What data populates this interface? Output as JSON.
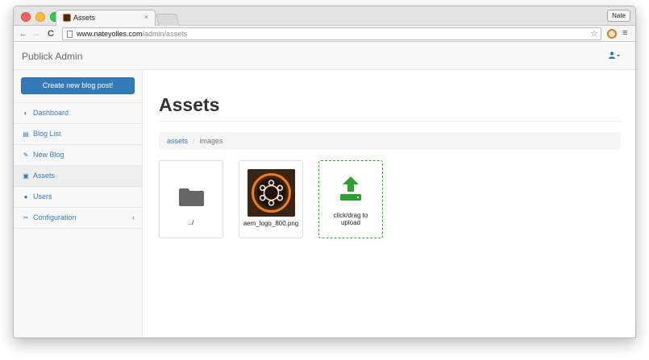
{
  "browser": {
    "tab_title": "Assets",
    "tab_close": "×",
    "profile_name": "Nate",
    "url_host": "www.nateyolles.com",
    "url_path": "/admin/assets",
    "back": "←",
    "forward": "→",
    "reload": "C",
    "star": "☆",
    "menu": "≡"
  },
  "app": {
    "brand": "Publick Admin",
    "user_menu": "▲ ▾"
  },
  "sidebar": {
    "create_button": "Create new blog post!",
    "items": [
      {
        "label": "Dashboard",
        "icon": "dashboard-icon",
        "glyph": "◐"
      },
      {
        "label": "Blog List",
        "icon": "list-icon",
        "glyph": "▤"
      },
      {
        "label": "New Blog",
        "icon": "pencil-icon",
        "glyph": "✎"
      },
      {
        "label": "Assets",
        "icon": "image-icon",
        "glyph": "▣"
      },
      {
        "label": "Users",
        "icon": "user-icon",
        "glyph": "●"
      },
      {
        "label": "Configuration",
        "icon": "wrench-icon",
        "glyph": "✂",
        "caret": "‹"
      }
    ]
  },
  "main": {
    "title": "Assets",
    "breadcrumb": {
      "root": "assets",
      "separator": "/",
      "current": "images"
    },
    "tiles": [
      {
        "type": "folder",
        "label": "../"
      },
      {
        "type": "image",
        "label": "aem_logo_800.png"
      },
      {
        "type": "upload",
        "label_line1": "click/drag to",
        "label_line2": "upload"
      }
    ]
  },
  "colors": {
    "link": "#337ab7",
    "upload_green": "#2ea02e",
    "folder_gray": "#666666"
  }
}
